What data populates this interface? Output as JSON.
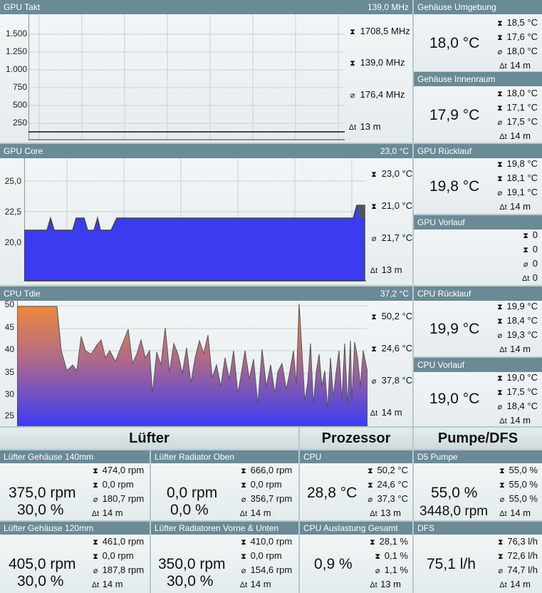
{
  "gpu_takt": {
    "title": "GPU Takt",
    "current": "139,0 MHz",
    "yticks": [
      "1.500",
      "1.250",
      "1.000",
      "750",
      "500",
      "250"
    ],
    "max": "1708,5 MHz",
    "min": "139,0 MHz",
    "avg": "176,4 MHz",
    "span": "13 m"
  },
  "gpu_core": {
    "title": "GPU Core",
    "current": "23,0 °C",
    "yticks": [
      "25,0",
      "22,5",
      "20,0"
    ],
    "max": "23,0 °C",
    "min": "21,0 °C",
    "avg": "21,7 °C",
    "span": "13 m"
  },
  "cpu_tdie": {
    "title": "CPU Tdie",
    "current": "37,2 °C",
    "yticks": [
      "50",
      "45",
      "40",
      "35",
      "30",
      "25"
    ],
    "max": "50,2 °C",
    "min": "24,6 °C",
    "avg": "37,8 °C",
    "span": "14 m"
  },
  "gehaeuse_umgebung": {
    "title": "Gehäuse Umgebung",
    "value": "18,0 °C",
    "max": "18,5 °C",
    "min": "17,6 °C",
    "avg": "18,0 °C",
    "span": "14 m"
  },
  "gehaeuse_innenraum": {
    "title": "Gehäuse Innenraum",
    "value": "17,9 °C",
    "max": "18,0 °C",
    "min": "17,1 °C",
    "avg": "17,5 °C",
    "span": "14 m"
  },
  "gpu_ruecklauf": {
    "title": "GPU Rücklauf",
    "value": "19,8 °C",
    "max": "19,8 °C",
    "min": "18,1 °C",
    "avg": "19,1 °C",
    "span": "14 m"
  },
  "gpu_vorlauf": {
    "title": "GPU Vorlauf",
    "max": "0",
    "min": "0",
    "avg": "0",
    "span": "0"
  },
  "cpu_ruecklauf": {
    "title": "CPU Rücklauf",
    "value": "19,9 °C",
    "max": "19,9 °C",
    "min": "18,4 °C",
    "avg": "19,3 °C",
    "span": "14 m"
  },
  "cpu_vorlauf": {
    "title": "CPU Vorlauf",
    "value": "19,0 °C",
    "max": "19,0 °C",
    "min": "17,5 °C",
    "avg": "18,4 °C",
    "span": "14 m"
  },
  "sections": {
    "luefter": "Lüfter",
    "prozessor": "Prozessor",
    "pumpe": "Pumpe/DFS"
  },
  "tiles": [
    {
      "title": "Lüfter Gehäuse 140mm",
      "v1": "375,0 rpm",
      "v2": "30,0 %",
      "max": "474,0 rpm",
      "min": "0,0 rpm",
      "avg": "180,7 rpm",
      "span": "14 m"
    },
    {
      "title": "Lüfter Radiator Oben",
      "v1": "0,0 rpm",
      "v2": "0,0 %",
      "max": "666,0 rpm",
      "min": "0,0 rpm",
      "avg": "356,7 rpm",
      "span": "14 m"
    },
    {
      "title": "CPU",
      "v1": "28,8 °C",
      "v2": "",
      "max": "50,2 °C",
      "min": "24,6 °C",
      "avg": "37,3 °C",
      "span": "13 m"
    },
    {
      "title": "D5 Pumpe",
      "v1": "55,0 %",
      "v2": "3448,0 rpm",
      "max": "55,0 %",
      "min": "55,0 %",
      "avg": "55,0 %",
      "span": "14 m"
    },
    {
      "title": "Lüfter Gehäuse 120mm",
      "v1": "405,0 rpm",
      "v2": "30,0 %",
      "max": "461,0 rpm",
      "min": "0,0 rpm",
      "avg": "187,8 rpm",
      "span": "14 m"
    },
    {
      "title": "Lüfter Radiatoren Vorne & Unten",
      "v1": "350,0 rpm",
      "v2": "30,0 %",
      "max": "410,0 rpm",
      "min": "0,0 rpm",
      "avg": "154,6 rpm",
      "span": "14 m"
    },
    {
      "title": "CPU Auslastung Gesamt",
      "v1": "0,9 %",
      "v2": "",
      "max": "28,1 %",
      "min": "0,1 %",
      "avg": "1,1 %",
      "span": "13 m"
    },
    {
      "title": "DFS",
      "v1": "75,1 l/h",
      "v2": "",
      "max": "76,3 l/h",
      "min": "72,6 l/h",
      "avg": "74,7 l/h",
      "span": "14 m"
    }
  ],
  "symbols": {
    "max": "⧗",
    "min": "⧗",
    "avg": "⌀",
    "span": "Δt"
  },
  "colors": {
    "header": "#6a8a96",
    "gpu_core_fill": "#3b3bf0",
    "tdie_top": "#f08a3a",
    "tdie_bottom": "#3c3cf5"
  }
}
